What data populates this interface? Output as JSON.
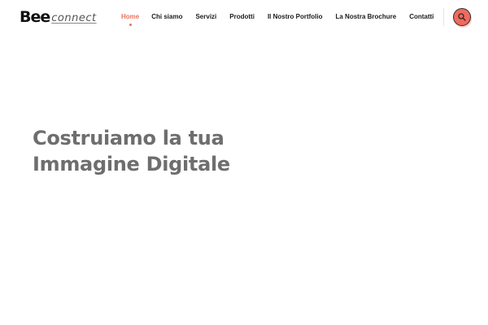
{
  "header": {
    "logo": {
      "bee_text": "Bee",
      "connect_text": "connect"
    },
    "nav": [
      {
        "label": "Home",
        "active": true
      },
      {
        "label": "Chi siamo",
        "active": false
      },
      {
        "label": "Servizi",
        "active": false
      },
      {
        "label": "Prodotti",
        "active": false
      },
      {
        "label": "Il Nostro Portfolio",
        "active": false
      },
      {
        "label": "La Nostra Brochure",
        "active": false
      },
      {
        "label": "Contatti",
        "active": false
      }
    ],
    "search_icon": "search-icon"
  },
  "hero": {
    "title_line1": "Costruiamo la tua",
    "title_line2": "Immagine Digitale"
  },
  "colors": {
    "accent": "#e8735d",
    "search_button": "#f06a5e",
    "hero_text": "#6e6e6e",
    "nav_text": "#1b1b1b",
    "logo_ring": "#f5b800"
  }
}
